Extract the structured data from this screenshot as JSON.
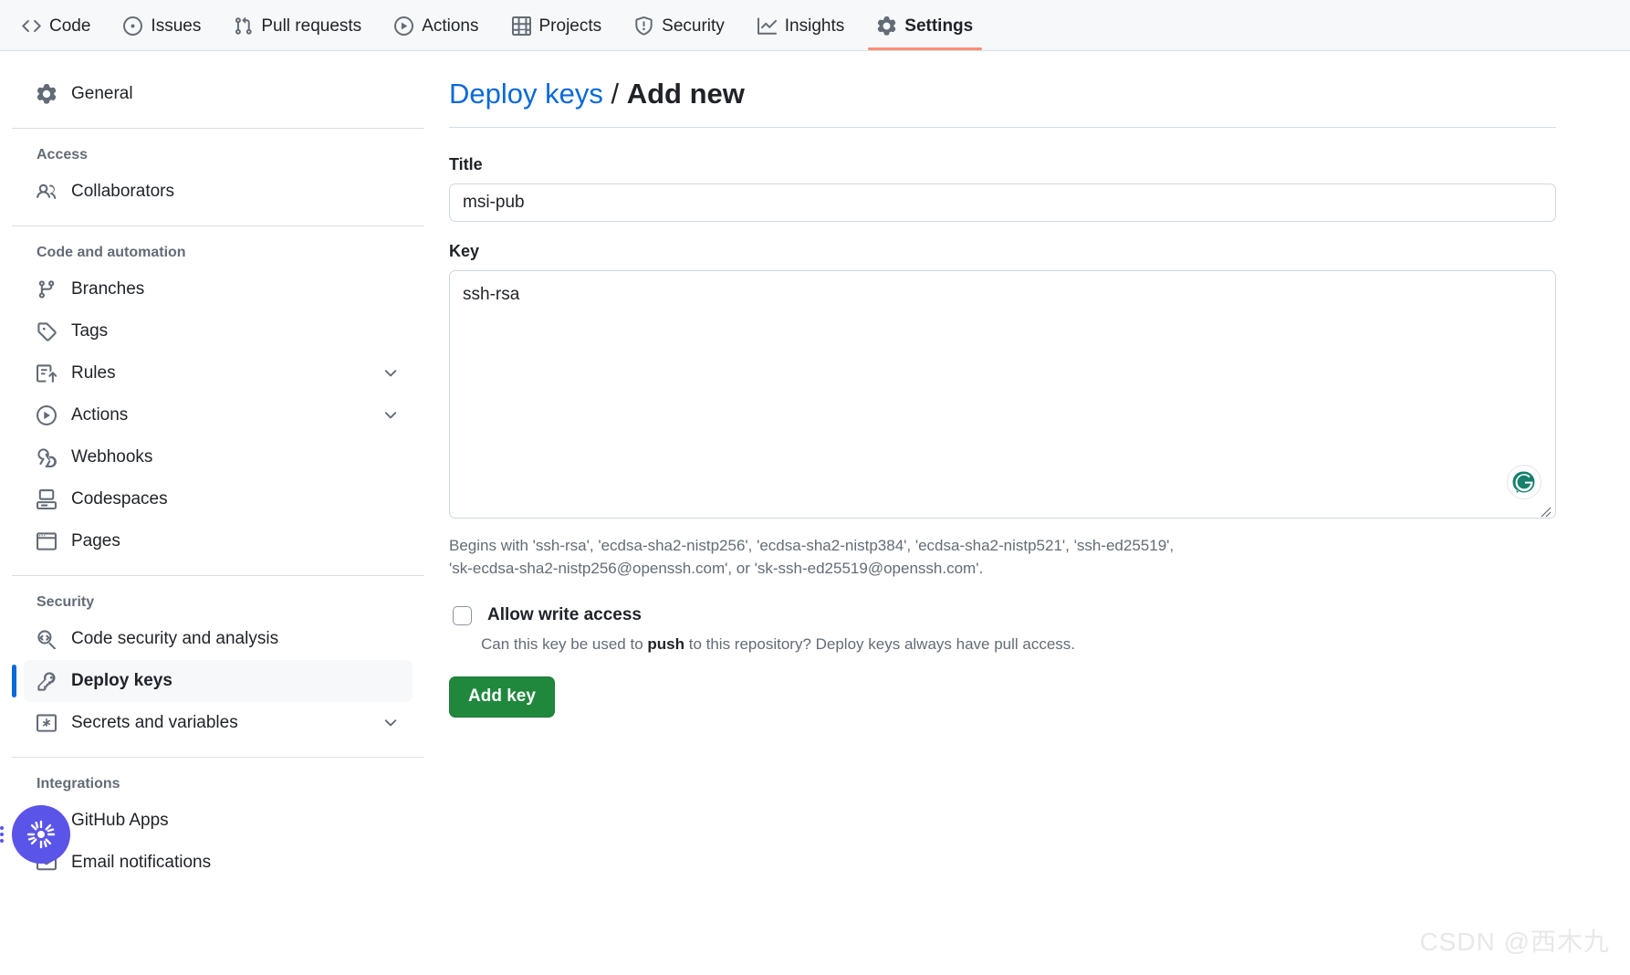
{
  "repo_nav": {
    "tabs": [
      {
        "label": "Code",
        "icon": "code-icon",
        "active": false
      },
      {
        "label": "Issues",
        "icon": "issue-opened-icon",
        "active": false
      },
      {
        "label": "Pull requests",
        "icon": "git-pull-request-icon",
        "active": false
      },
      {
        "label": "Actions",
        "icon": "play-icon",
        "active": false
      },
      {
        "label": "Projects",
        "icon": "table-icon",
        "active": false
      },
      {
        "label": "Security",
        "icon": "shield-icon",
        "active": false
      },
      {
        "label": "Insights",
        "icon": "graph-icon",
        "active": false
      },
      {
        "label": "Settings",
        "icon": "gear-icon",
        "active": true
      }
    ],
    "active_underline_color": "#fd8c73"
  },
  "sidebar": {
    "top_items": [
      {
        "label": "General",
        "icon": "gear-icon"
      }
    ],
    "sections": [
      {
        "heading": "Access",
        "items": [
          {
            "label": "Collaborators",
            "icon": "people-icon",
            "expandable": false,
            "selected": false
          }
        ]
      },
      {
        "heading": "Code and automation",
        "items": [
          {
            "label": "Branches",
            "icon": "git-branch-icon",
            "expandable": false,
            "selected": false
          },
          {
            "label": "Tags",
            "icon": "tag-icon",
            "expandable": false,
            "selected": false
          },
          {
            "label": "Rules",
            "icon": "rules-icon",
            "expandable": true,
            "selected": false
          },
          {
            "label": "Actions",
            "icon": "play-icon",
            "expandable": true,
            "selected": false
          },
          {
            "label": "Webhooks",
            "icon": "webhook-icon",
            "expandable": false,
            "selected": false
          },
          {
            "label": "Codespaces",
            "icon": "codespaces-icon",
            "expandable": false,
            "selected": false
          },
          {
            "label": "Pages",
            "icon": "browser-icon",
            "expandable": false,
            "selected": false
          }
        ]
      },
      {
        "heading": "Security",
        "items": [
          {
            "label": "Code security and analysis",
            "icon": "code-scan-icon",
            "expandable": false,
            "selected": false
          },
          {
            "label": "Deploy keys",
            "icon": "key-icon",
            "expandable": false,
            "selected": true
          },
          {
            "label": "Secrets and variables",
            "icon": "asterisk-box-icon",
            "expandable": true,
            "selected": false
          }
        ]
      },
      {
        "heading": "Integrations",
        "items": [
          {
            "label": "GitHub Apps",
            "icon": "apps-icon",
            "expandable": false,
            "selected": false
          },
          {
            "label": "Email notifications",
            "icon": "mail-icon",
            "expandable": false,
            "selected": false
          }
        ]
      }
    ],
    "selected_marker_color": "#0969da"
  },
  "main": {
    "breadcrumb": {
      "parent": "Deploy keys",
      "separator": "/",
      "current": "Add new"
    },
    "title_field": {
      "label": "Title",
      "value": "msi-pub",
      "placeholder": ""
    },
    "key_field": {
      "label": "Key",
      "value": "ssh-rsa",
      "placeholder": "",
      "help_line_1": "Begins with 'ssh-rsa', 'ecdsa-sha2-nistp256', 'ecdsa-sha2-nistp384', 'ecdsa-sha2-nistp521', 'ssh-ed25519',",
      "help_line_2": "'sk-ecdsa-sha2-nistp256@openssh.com', or 'sk-ssh-ed25519@openssh.com'."
    },
    "grammarly": {
      "icon": "grammarly-icon",
      "letter": "G",
      "color": "#15806c"
    },
    "write_access": {
      "label": "Allow write access",
      "checked": false,
      "description_before": "Can this key be used to ",
      "description_bold": "push",
      "description_after": " to this repository? Deploy keys always have pull access."
    },
    "submit_button": {
      "label": "Add key",
      "color": "#1f883d"
    }
  },
  "floating_button": {
    "icon": "sunburst-icon",
    "color": "#5b54e8"
  },
  "watermark": {
    "text": "CSDN @西木九"
  }
}
